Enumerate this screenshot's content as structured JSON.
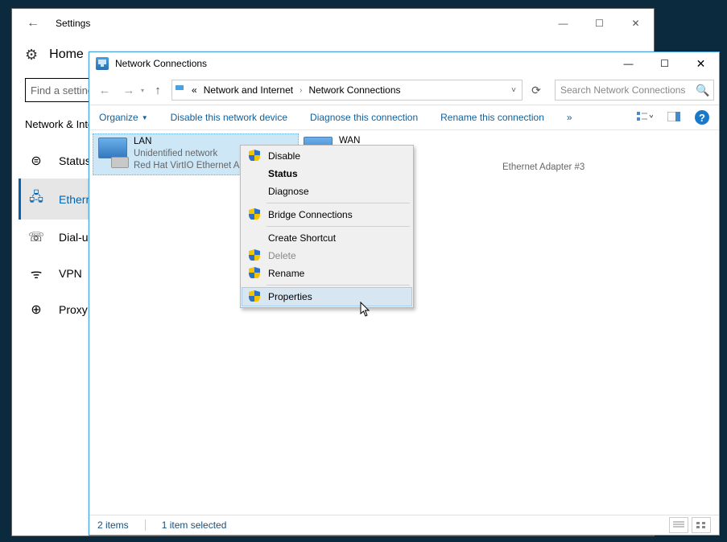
{
  "settings_window": {
    "title": "Settings",
    "home_label": "Home",
    "search_placeholder": "Find a setting",
    "section_title": "Network & Internet",
    "nav": [
      {
        "icon": "status-icon",
        "label": "Status"
      },
      {
        "icon": "ethernet-icon",
        "label": "Ethernet"
      },
      {
        "icon": "dialup-icon",
        "label": "Dial-up"
      },
      {
        "icon": "vpn-icon",
        "label": "VPN"
      },
      {
        "icon": "proxy-icon",
        "label": "Proxy"
      }
    ]
  },
  "nc_window": {
    "title": "Network Connections",
    "breadcrumb_root": "«",
    "breadcrumb": [
      "Network and Internet",
      "Network Connections"
    ],
    "search_placeholder": "Search Network Connections",
    "toolbar": {
      "organize": "Organize",
      "disable": "Disable this network device",
      "diagnose": "Diagnose this connection",
      "rename": "Rename this connection",
      "overflow": "»"
    },
    "adapters": {
      "lan": {
        "name": "LAN",
        "sub1": "Unidentified network",
        "sub2": "Red Hat VirtIO Ethernet Adapter"
      },
      "wan": {
        "name": "WAN",
        "sub_visible": "Ethernet Adapter #3"
      }
    },
    "context_menu": {
      "disable": "Disable",
      "status": "Status",
      "diagnose": "Diagnose",
      "bridge": "Bridge Connections",
      "shortcut": "Create Shortcut",
      "delete": "Delete",
      "rename": "Rename",
      "properties": "Properties"
    },
    "status_bar": {
      "count": "2 items",
      "selected": "1 item selected"
    }
  }
}
